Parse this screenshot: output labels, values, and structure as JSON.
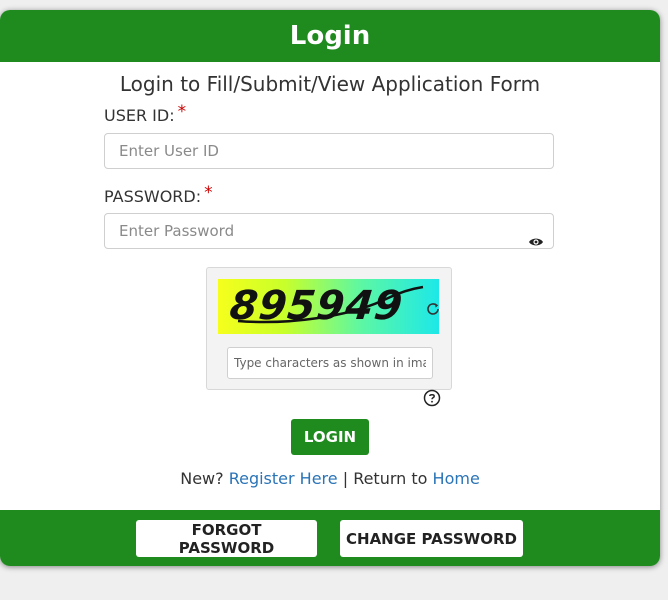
{
  "header": {
    "title": "Login"
  },
  "form": {
    "subtitle": "Login to Fill/Submit/View Application Form",
    "user_id": {
      "label": "USER ID:",
      "required_mark": "*",
      "placeholder": "Enter User ID",
      "value": ""
    },
    "password": {
      "label": "PASSWORD:",
      "required_mark": "*",
      "placeholder": "Enter Password",
      "value": ""
    },
    "captcha": {
      "code": "895949",
      "placeholder": "Type characters as shown in image",
      "value": ""
    },
    "login_button": "LOGIN",
    "links": {
      "new_prefix": "New?",
      "register_label": "Register Here",
      "separator": "|",
      "return_prefix": "Return to",
      "home_label": "Home"
    }
  },
  "footer": {
    "forgot_password_label": "FORGOT PASSWORD",
    "change_password_label": "CHANGE PASSWORD"
  },
  "icons": {
    "password_toggle": "eye-icon",
    "captcha_refresh": "refresh-icon",
    "captcha_help": "help-circle-icon"
  },
  "colors": {
    "brand_green": "#1f8b1f",
    "link_blue": "#2a74b8",
    "required_red": "#cc0000"
  }
}
